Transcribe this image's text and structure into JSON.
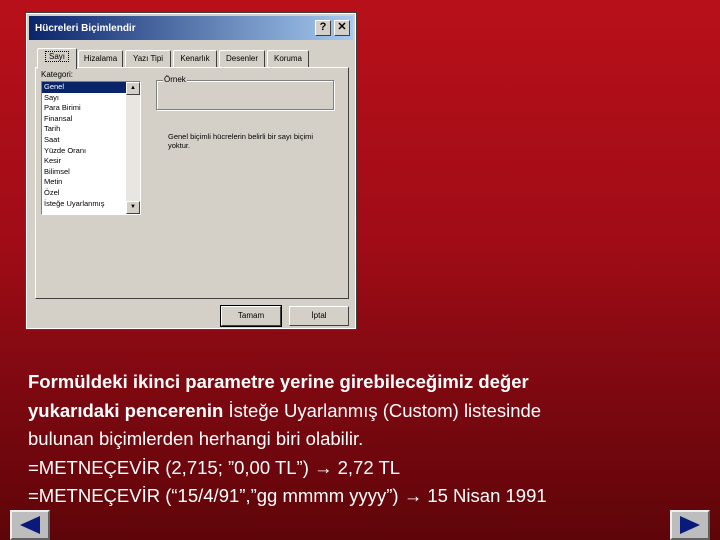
{
  "dialog": {
    "title": "Hücreleri Biçimlendir",
    "help_label": "?",
    "close_label": "✕",
    "tabs": [
      {
        "label": "Sayı",
        "active": true
      },
      {
        "label": "Hizalama",
        "active": false
      },
      {
        "label": "Yazı Tipi",
        "active": false
      },
      {
        "label": "Kenarlık",
        "active": false
      },
      {
        "label": "Desenler",
        "active": false
      },
      {
        "label": "Koruma",
        "active": false
      }
    ],
    "category_label": "Kategori:",
    "categories": [
      "Genel",
      "Sayı",
      "Para Birimi",
      "Finansal",
      "Tarih",
      "Saat",
      "Yüzde Oranı",
      "Kesir",
      "Bilimsel",
      "Metin",
      "Özel",
      "İsteğe Uyarlanmış"
    ],
    "selected_category": "Genel",
    "ornek_label": "Örnek",
    "description": "Genel biçimli hücrelerin belirli bir sayı biçimi yoktur.",
    "ok_label": "Tamam",
    "cancel_label": "İptal",
    "scroll_up": "▲",
    "scroll_down": "▼"
  },
  "text": {
    "line1": "Formüldeki ikinci parametre yerine girebileceğimiz değer",
    "line2_bold": "yukarıdaki pencerenin",
    "line2_rest": " İsteğe Uyarlanmış (Custom) listesinde",
    "line3": "bulunan biçimlerden herhangi biri olabilir.",
    "line4": "=METNEÇEVİR (2,715; ”0,00 TL”) → 2,72 TL",
    "line5": "=METNEÇEVİR (“15/4/91”,”gg mmmm yyyy”) → 15 Nisan 1991"
  },
  "nav": {
    "prev_icon": "triangle-left-icon",
    "next_icon": "triangle-right-icon",
    "icon_color": "#0a1a7a"
  }
}
